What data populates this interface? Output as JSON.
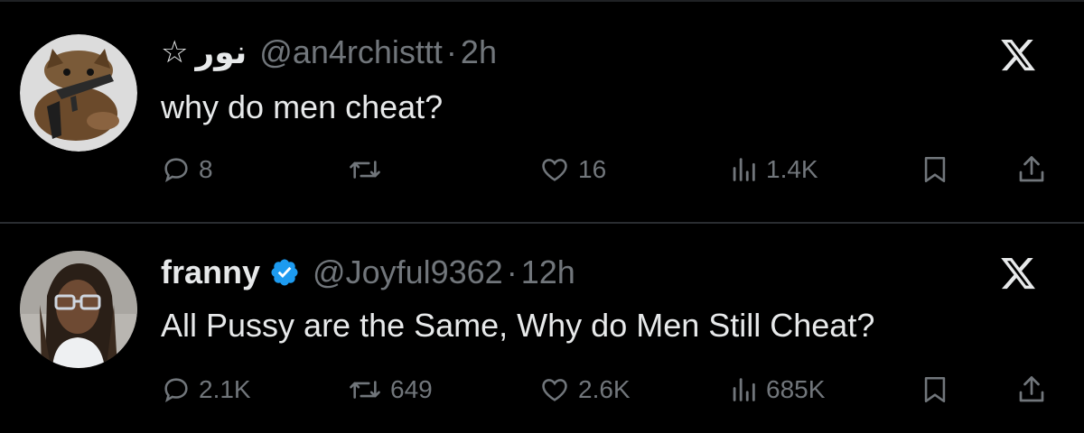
{
  "tweets": [
    {
      "display_name": "نور",
      "name_prefix_icon": "star-outline-icon",
      "handle": "@an4rchisttt",
      "separator": "·",
      "time": "2h",
      "verified": false,
      "text": "why do men cheat?",
      "avatar": "cat-with-rifle-avatar",
      "actions": {
        "replies": "8",
        "retweets": "",
        "likes": "16",
        "views": "1.4K"
      }
    },
    {
      "display_name": "franny",
      "handle": "@Joyful9362",
      "separator": "·",
      "time": "12h",
      "verified": true,
      "verified_color": "#1d9bf0",
      "text": "All Pussy are the Same, Why do Men Still Cheat?",
      "avatar": "woman-with-glasses-avatar",
      "actions": {
        "replies": "2.1K",
        "retweets": "649",
        "likes": "2.6K",
        "views": "685K"
      }
    }
  ],
  "colors": {
    "background": "#000000",
    "text_primary": "#e7e9ea",
    "text_secondary": "#71767b",
    "divider": "#2a2d31"
  }
}
